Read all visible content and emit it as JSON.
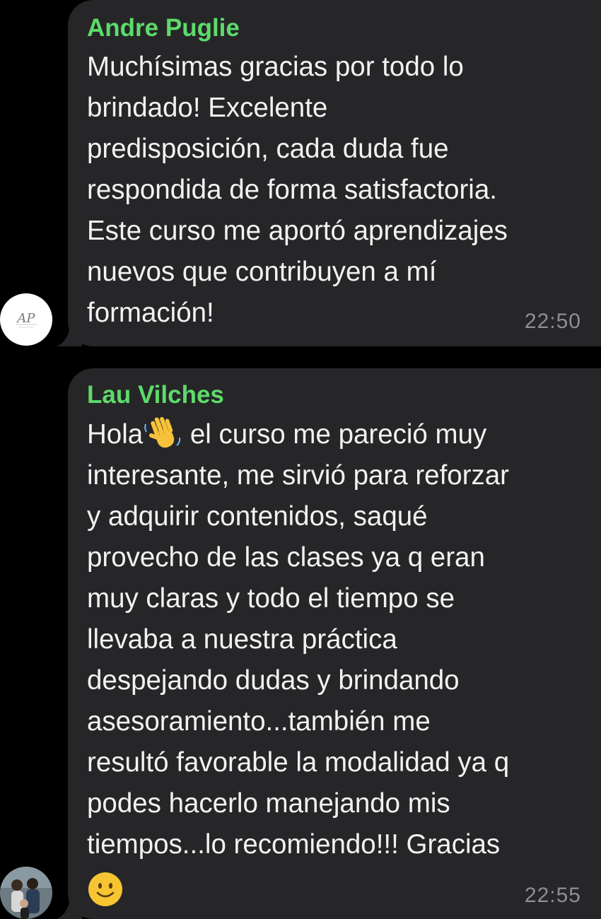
{
  "messages": [
    {
      "sender": "Andre Puglie",
      "avatar": "logo-monogram-icon",
      "lines": [
        "Muchísimas gracias por todo lo",
        "brindado! Excelente",
        "predisposición,  cada duda fue",
        "respondida de forma satisfactoria.",
        "Este curso me aportó aprendizajes",
        "nuevos que contribuyen a mí",
        "formación!"
      ],
      "time": "22:50"
    },
    {
      "sender": "Lau Vilches",
      "avatar": "user-photo-avatar",
      "first_line_start": "Hola",
      "first_line_rest": " el curso me pareció muy",
      "lines": [
        "interesante, me sirvió para reforzar",
        "y adquirir contenidos,  saqué",
        "provecho de las clases ya q eran",
        "muy claras y todo el tiempo se",
        "llevaba a nuestra práctica",
        "despejando dudas y brindando",
        "asesoramiento...también me",
        "resultó favorable la modalidad ya q",
        "podes hacerlo manejando mis",
        "tiempos...lo recomiendo!!! Gracias"
      ],
      "emojis": [
        "waving-hand-emoji",
        "smiling-face-emoji"
      ],
      "time": "22:55"
    }
  ],
  "colors": {
    "background": "#000000",
    "bubble": "#262628",
    "sender_name": "#5ddb6a",
    "message_text": "#f2f2f2",
    "timestamp": "#8e8e93"
  }
}
